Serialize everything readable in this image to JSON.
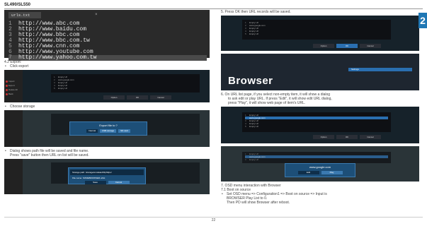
{
  "header": {
    "model": "SL490/SL550"
  },
  "terminal": {
    "tab_label": "urls.txt",
    "tab_close": "×",
    "lines": [
      {
        "n": "1",
        "text": "http://www.abc.com"
      },
      {
        "n": "2",
        "text": "http://www.baidu.com"
      },
      {
        "n": "3",
        "text": "http://www.bbc.com"
      },
      {
        "n": "4",
        "text": "http://www.bbc.com.tw"
      },
      {
        "n": "5",
        "text": "http://www.cnn.com"
      },
      {
        "n": "6",
        "text": "http://www.youtube.com"
      },
      {
        "n": "7",
        "text": "http://www.yahoo.com.tw"
      }
    ]
  },
  "left": {
    "export_heading": "4.2 Export:",
    "click_export": "Click export",
    "choose_storage": "Choose storage",
    "dialog_text_1": "Dialog shows path file will be saved and file name.",
    "dialog_text_2": "Press \"save\" button then URL on list will be saved."
  },
  "shot1": {
    "sidebar": [
      "Import",
      "Export",
      "Delete All",
      "Back"
    ],
    "rows": [
      {
        "n": "1",
        "t": "Empty Url"
      },
      {
        "n": "2",
        "t": "www.google.com"
      },
      {
        "n": "3",
        "t": "Empty Url"
      },
      {
        "n": "4",
        "t": "Empty Url"
      },
      {
        "n": "5",
        "t": "Empty Url"
      }
    ],
    "buttons": [
      "Option",
      "OK",
      "Cancel"
    ]
  },
  "shot2": {
    "dialog_title": "Export file to ?",
    "options": [
      "Internal",
      "USB storage",
      "SD card"
    ]
  },
  "shot3": {
    "path_label": "Storage path: /storage/emulated/0/philips/",
    "file_label": "File name: SOMEBROWSER.urlist",
    "buttons": [
      "Save",
      "Cancel"
    ]
  },
  "right": {
    "step5": "5.   Press OK then URL records will be saved.",
    "step6_1": "6.   On URL list page, if you select non-empty item, it will show a dialog",
    "step6_2": "to ask edit or play URL. If press \"Edit\", it will show edit URL dialog,",
    "step6_3": "press \"Play\", it will show web page of item's URL.",
    "step7": "7.   OSD menu interaction with Browser",
    "step71": "7.1 Boot on source",
    "boot_1": "Set OSD menu => Configuration1 => Boot on source => Input is",
    "boot_2": "BROWSER Play List to 0.",
    "boot_3": "Then PD will show Browser after reboot."
  },
  "shot4": {
    "rows": [
      {
        "n": "1",
        "t": "Empty Url"
      },
      {
        "n": "2",
        "t": "www.google.com"
      },
      {
        "n": "3",
        "t": "Empty Url"
      },
      {
        "n": "4",
        "t": "Empty Url"
      },
      {
        "n": "5",
        "t": "Empty Url"
      }
    ],
    "buttons": [
      "Option",
      "OK",
      "Cancel"
    ]
  },
  "shot5": {
    "bar_label": "Settings",
    "word": "Browser"
  },
  "shot6": {
    "rows": [
      {
        "n": "1",
        "t": "Empty Url"
      },
      {
        "n": "2",
        "t": "www.google.com"
      },
      {
        "n": "3",
        "t": "Empty Url"
      },
      {
        "n": "4",
        "t": "Empty Url"
      },
      {
        "n": "5",
        "t": "Empty Url"
      }
    ],
    "buttons": [
      "Option",
      "OK",
      "Cancel"
    ]
  },
  "shot7": {
    "rows": [
      {
        "n": "1",
        "t": "Empty Url"
      },
      {
        "n": "2",
        "t": "www.google.com"
      },
      {
        "n": "3",
        "t": "Empty Url"
      }
    ],
    "dialog_title": "www.google.com",
    "options": [
      "Edit",
      "Play"
    ]
  },
  "footer": {
    "page_no": "22"
  },
  "tab": {
    "label": "2"
  }
}
